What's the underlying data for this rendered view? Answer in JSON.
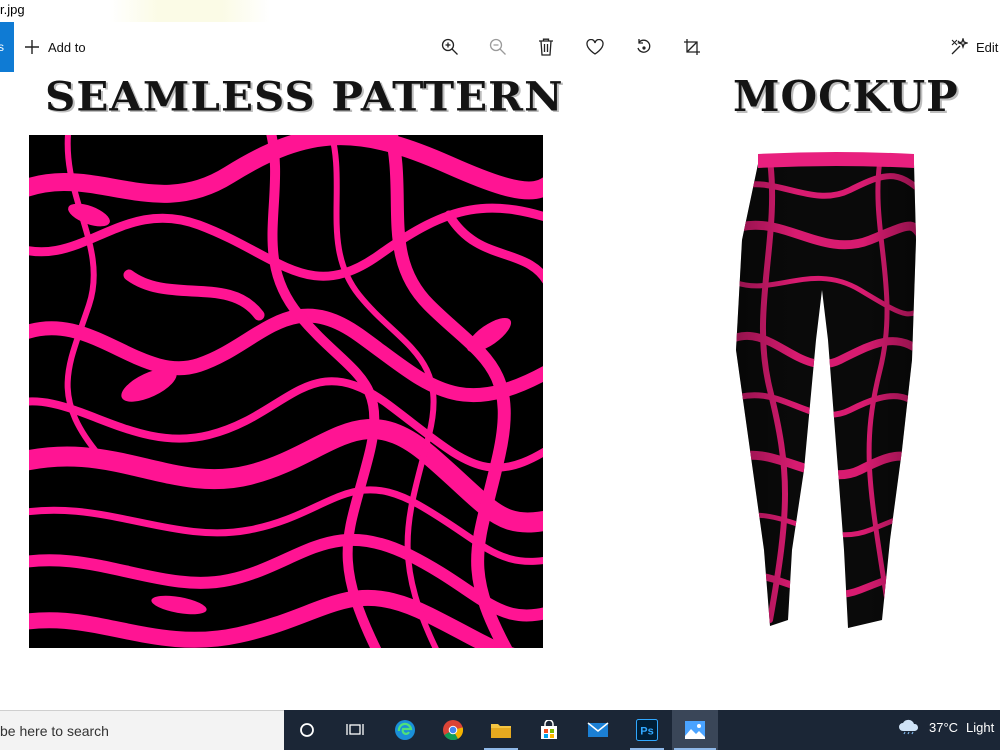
{
  "window": {
    "title": "r.jpg"
  },
  "toolbar": {
    "back_label": "s",
    "add_to_label": "Add to",
    "edit_label": "Edit",
    "icons": [
      "zoom-in-icon",
      "zoom-out-icon",
      "delete-icon",
      "favorite-icon",
      "rotate-icon",
      "crop-icon"
    ]
  },
  "image": {
    "left_heading": "SEAMLESS PATTERN",
    "right_heading": "MOCKUP",
    "colors": {
      "pink": "#ff1493",
      "black": "#000000",
      "waistband": "#e8207e"
    }
  },
  "taskbar": {
    "search_placeholder": "be here to search",
    "apps": [
      "task-view-icon",
      "edge-icon",
      "chrome-icon",
      "file-explorer-icon",
      "store-icon",
      "mail-icon",
      "photoshop-icon",
      "photos-icon"
    ],
    "photoshop_label": "Ps",
    "weather_temp": "37°C",
    "weather_text": "Light"
  }
}
